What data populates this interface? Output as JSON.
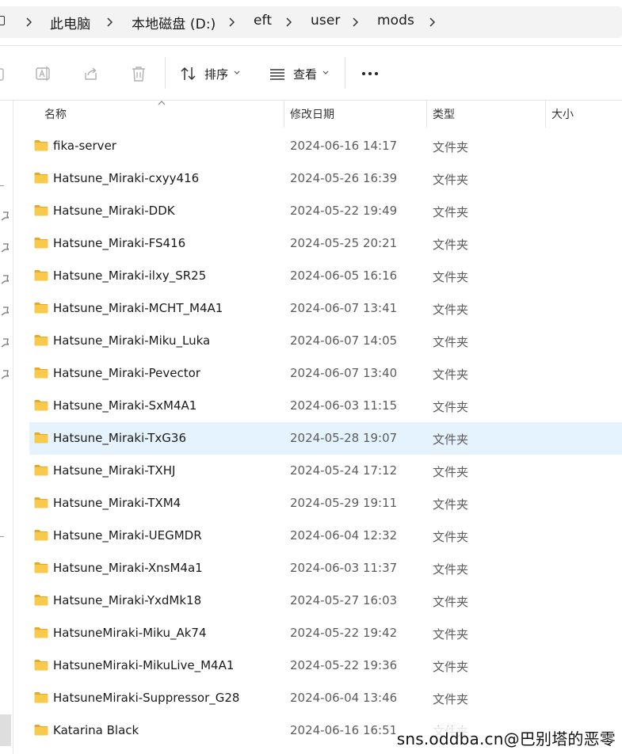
{
  "breadcrumb": [
    "此电脑",
    "本地磁盘 (D:)",
    "eft",
    "user",
    "mods"
  ],
  "toolbar": {
    "sort_label": "排序",
    "view_label": "查看"
  },
  "columns": {
    "name": "名称",
    "date": "修改日期",
    "type": "类型",
    "size": "大小"
  },
  "rows": [
    {
      "name": "fika-server",
      "date": "2024-06-16 14:17",
      "type": "文件夹"
    },
    {
      "name": "Hatsune_Miraki-cxyy416",
      "date": "2024-05-26 16:39",
      "type": "文件夹"
    },
    {
      "name": "Hatsune_Miraki-DDK",
      "date": "2024-05-22 19:49",
      "type": "文件夹"
    },
    {
      "name": "Hatsune_Miraki-FS416",
      "date": "2024-05-25 20:21",
      "type": "文件夹"
    },
    {
      "name": "Hatsune_Miraki-ilxy_SR25",
      "date": "2024-06-05 16:16",
      "type": "文件夹"
    },
    {
      "name": "Hatsune_Miraki-MCHT_M4A1",
      "date": "2024-06-07 13:41",
      "type": "文件夹"
    },
    {
      "name": "Hatsune_Miraki-Miku_Luka",
      "date": "2024-06-07 14:05",
      "type": "文件夹"
    },
    {
      "name": "Hatsune_Miraki-Pevector",
      "date": "2024-06-07 13:40",
      "type": "文件夹"
    },
    {
      "name": "Hatsune_Miraki-SxM4A1",
      "date": "2024-06-03 11:15",
      "type": "文件夹"
    },
    {
      "name": "Hatsune_Miraki-TxG36",
      "date": "2024-05-28 19:07",
      "type": "文件夹",
      "selected": true
    },
    {
      "name": "Hatsune_Miraki-TXHJ",
      "date": "2024-05-24 17:12",
      "type": "文件夹"
    },
    {
      "name": "Hatsune_Miraki-TXM4",
      "date": "2024-05-29 19:11",
      "type": "文件夹"
    },
    {
      "name": "Hatsune_Miraki-UEGMDR",
      "date": "2024-06-04 12:32",
      "type": "文件夹"
    },
    {
      "name": "Hatsune_Miraki-XnsM4a1",
      "date": "2024-06-03 11:37",
      "type": "文件夹"
    },
    {
      "name": "Hatsune_Miraki-YxdMk18",
      "date": "2024-05-27 16:03",
      "type": "文件夹"
    },
    {
      "name": "HatsuneMiraki-Miku_Ak74",
      "date": "2024-05-22 19:42",
      "type": "文件夹"
    },
    {
      "name": "HatsuneMiraki-MikuLive_M4A1",
      "date": "2024-05-22 19:36",
      "type": "文件夹"
    },
    {
      "name": "HatsuneMiraki-Suppressor_G28",
      "date": "2024-06-04 13:46",
      "type": "文件夹"
    },
    {
      "name": "Katarina Black",
      "date": "2024-06-16 16:51",
      "type": "文件夹"
    }
  ],
  "watermark": "sns.oddba.cn@巴别塔的恶零",
  "colors": {
    "selected_row": "#e5f3ff",
    "folder_yellow": "#f8c94a",
    "folder_back": "#e8a92a"
  }
}
